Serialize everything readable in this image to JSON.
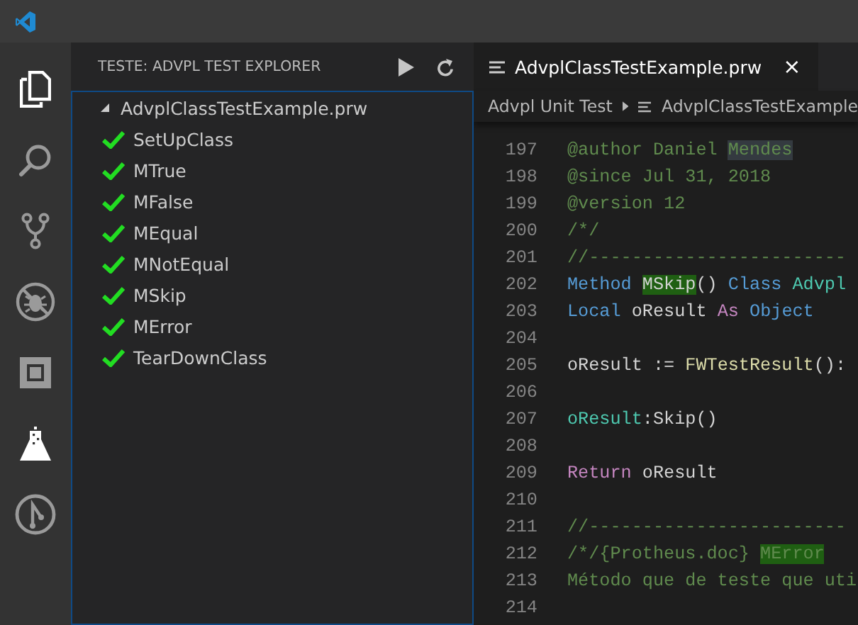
{
  "activity_bar": [
    {
      "kind": "files",
      "selected": true
    },
    {
      "kind": "search",
      "selected": false
    },
    {
      "kind": "branch",
      "selected": false
    },
    {
      "kind": "debug",
      "selected": false
    },
    {
      "kind": "extensions",
      "selected": false
    },
    {
      "kind": "flask",
      "selected": true
    },
    {
      "kind": "circle",
      "selected": false
    }
  ],
  "sidebar": {
    "title": "TESTE: ADVPL TEST EXPLORER",
    "tree": [
      {
        "label": "AdvplClassTestExample.prw",
        "expanded": true,
        "children": [
          {
            "label": "SetUpClass",
            "passed": true
          },
          {
            "label": "MTrue",
            "passed": true
          },
          {
            "label": "MFalse",
            "passed": true
          },
          {
            "label": "MEqual",
            "passed": true
          },
          {
            "label": "MNotEqual",
            "passed": true
          },
          {
            "label": "MSkip",
            "passed": true
          },
          {
            "label": "MError",
            "passed": true
          },
          {
            "label": "TearDownClass",
            "passed": true
          }
        ]
      }
    ]
  },
  "editor": {
    "tabs": [
      {
        "label": "AdvplClassTestExample.prw",
        "selected": true,
        "close": "×"
      }
    ],
    "breadcrumb": [
      "Advpl Unit Test",
      "AdvplClassTestExample"
    ],
    "lines": [
      {
        "number": "197",
        "tokens": [
          {
            "text": "@author Daniel ",
            "kind": "comment"
          },
          {
            "text": "Mendes",
            "kind": "comment",
            "selected": true
          }
        ]
      },
      {
        "number": "198",
        "tokens": [
          {
            "text": "@since Jul 31, 2018",
            "kind": "comment"
          }
        ]
      },
      {
        "number": "199",
        "tokens": [
          {
            "text": "@version 12",
            "kind": "comment"
          }
        ]
      },
      {
        "number": "200",
        "tokens": [
          {
            "text": "/*/",
            "kind": "comment"
          }
        ]
      },
      {
        "number": "201",
        "tokens": [
          {
            "text": "//------------------------",
            "kind": "comment"
          }
        ]
      },
      {
        "number": "202",
        "tokens": [
          {
            "text": "Method ",
            "kind": "keyword"
          },
          {
            "text": "MSkip",
            "kind": "plain",
            "matched": true
          },
          {
            "text": "() ",
            "kind": "plain"
          },
          {
            "text": "Class ",
            "kind": "keyword"
          },
          {
            "text": "Advpl",
            "kind": "type"
          }
        ]
      },
      {
        "number": "203",
        "tokens": [
          {
            "text": "Local ",
            "kind": "keyword"
          },
          {
            "text": "oResult ",
            "kind": "plain"
          },
          {
            "text": "As ",
            "kind": "control"
          },
          {
            "text": "Object",
            "kind": "keyword"
          }
        ]
      },
      {
        "number": "204"
      },
      {
        "number": "205",
        "tokens": [
          {
            "text": "oResult := ",
            "kind": "plain"
          },
          {
            "text": "FWTestResult",
            "kind": "function"
          },
          {
            "text": "():",
            "kind": "plain"
          }
        ]
      },
      {
        "number": "206"
      },
      {
        "number": "207",
        "tokens": [
          {
            "text": "oResult",
            "kind": "type"
          },
          {
            "text": ":Skip()",
            "kind": "plain"
          }
        ]
      },
      {
        "number": "208"
      },
      {
        "number": "209",
        "tokens": [
          {
            "text": "Return ",
            "kind": "control"
          },
          {
            "text": "oResult",
            "kind": "plain"
          }
        ]
      },
      {
        "number": "210"
      },
      {
        "number": "211",
        "tokens": [
          {
            "text": "//------------------------",
            "kind": "comment"
          }
        ]
      },
      {
        "number": "212",
        "tokens": [
          {
            "text": "/*/{Protheus.doc} ",
            "kind": "comment"
          },
          {
            "text": "MError",
            "kind": "comment",
            "matched": true
          }
        ]
      },
      {
        "number": "213",
        "tokens": [
          {
            "text": "Método que de teste que uti",
            "kind": "comment"
          }
        ]
      },
      {
        "number": "214"
      }
    ]
  }
}
